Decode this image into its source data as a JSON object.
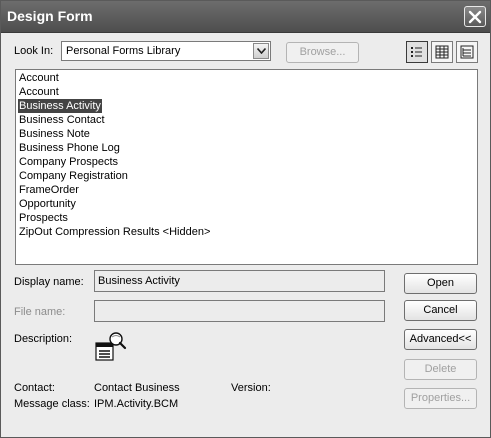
{
  "window": {
    "title": "Design Form"
  },
  "look_in": {
    "label": "Look In:",
    "value": "Personal Forms Library",
    "browse_label": "Browse..."
  },
  "view_buttons": [
    "large-icons",
    "list",
    "details"
  ],
  "forms_list": {
    "selected_index": 2,
    "items": [
      "Account",
      "Account",
      "Business Activity",
      "Business Contact",
      "Business Note",
      "Business Phone Log",
      "Company Prospects",
      "Company Registration",
      "FrameOrder",
      "Opportunity",
      "Prospects",
      "ZipOut Compression Results <Hidden>"
    ]
  },
  "fields": {
    "display_name_label": "Display name:",
    "display_name_value": "Business Activity",
    "file_name_label": "File name:",
    "file_name_value": "",
    "description_label": "Description:"
  },
  "buttons": {
    "open": "Open",
    "cancel": "Cancel",
    "advanced": "Advanced<<",
    "delete": "Delete",
    "properties": "Properties..."
  },
  "details": {
    "contact_label": "Contact:",
    "contact_value": "Contact Business",
    "version_label": "Version:",
    "version_value": "",
    "message_class_label": "Message class:",
    "message_class_value": "IPM.Activity.BCM"
  }
}
